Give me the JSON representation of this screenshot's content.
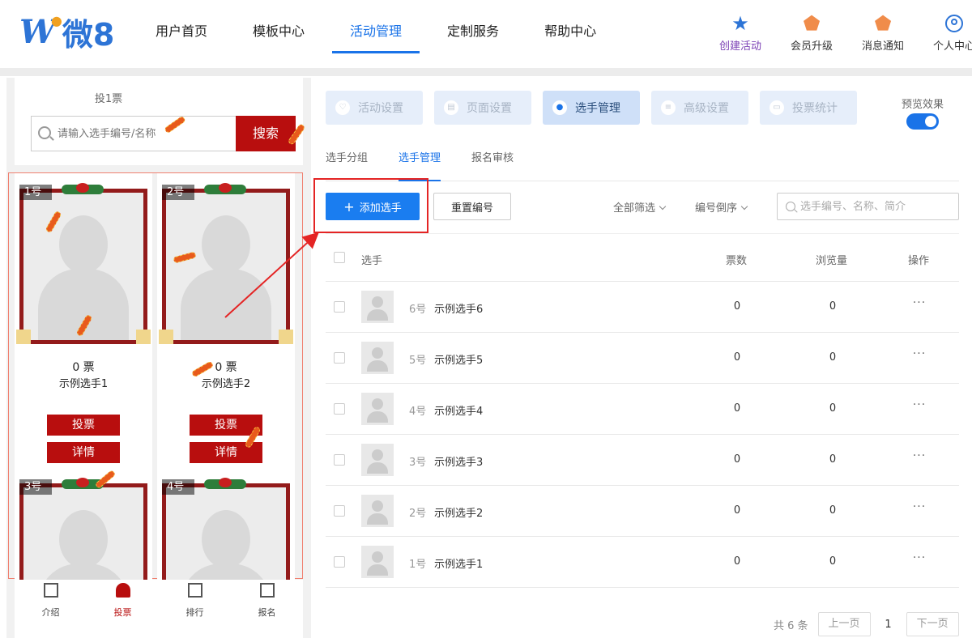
{
  "header": {
    "logo": {
      "letter": "W",
      "text": "微8"
    },
    "nav": [
      {
        "label": "用户首页",
        "active": false
      },
      {
        "label": "模板中心",
        "active": false
      },
      {
        "label": "活动管理",
        "active": true
      },
      {
        "label": "定制服务",
        "active": false
      },
      {
        "label": "帮助中心",
        "active": false
      }
    ],
    "tools": [
      {
        "label": "创建活动",
        "icon": "star-icon"
      },
      {
        "label": "会员升级",
        "icon": "shield-icon"
      },
      {
        "label": "消息通知",
        "icon": "shield-icon"
      },
      {
        "label": "个人中心",
        "icon": "user-icon"
      }
    ]
  },
  "phone": {
    "votes_label": "投1票",
    "search_placeholder": "请输入选手编号/名称",
    "search_button": "搜索",
    "cards": [
      {
        "badge": "1号",
        "votes": "0 票",
        "name": "示例选手1",
        "vote_btn": "投票",
        "detail_btn": "详情"
      },
      {
        "badge": "2号",
        "votes": "0 票",
        "name": "示例选手2",
        "vote_btn": "投票",
        "detail_btn": "详情"
      },
      {
        "badge": "3号"
      },
      {
        "badge": "4号"
      }
    ],
    "tabbar": [
      {
        "label": "介绍",
        "active": false
      },
      {
        "label": "投票",
        "active": true
      },
      {
        "label": "排行",
        "active": false
      },
      {
        "label": "报名",
        "active": false
      }
    ]
  },
  "steps": [
    {
      "label": "活动设置",
      "active": false
    },
    {
      "label": "页面设置",
      "active": false
    },
    {
      "label": "选手管理",
      "active": true
    },
    {
      "label": "高级设置",
      "active": false
    },
    {
      "label": "投票统计",
      "active": false
    }
  ],
  "preview": {
    "label": "预览效果",
    "on": true
  },
  "subtabs": [
    {
      "label": "选手分组",
      "active": false
    },
    {
      "label": "选手管理",
      "active": true
    },
    {
      "label": "报名审核",
      "active": false
    }
  ],
  "toolbar": {
    "add_label": "添加选手",
    "renumber_label": "重置编号",
    "filter_label": "全部筛选",
    "sort_label": "编号倒序",
    "search_placeholder": "选手编号、名称、简介"
  },
  "table": {
    "headers": {
      "player": "选手",
      "votes": "票数",
      "views": "浏览量",
      "ops": "操作"
    },
    "rows": [
      {
        "num": "6号",
        "name": "示例选手6",
        "votes": "0",
        "views": "0",
        "ops": "···"
      },
      {
        "num": "5号",
        "name": "示例选手5",
        "votes": "0",
        "views": "0",
        "ops": "···"
      },
      {
        "num": "4号",
        "name": "示例选手4",
        "votes": "0",
        "views": "0",
        "ops": "···"
      },
      {
        "num": "3号",
        "name": "示例选手3",
        "votes": "0",
        "views": "0",
        "ops": "···"
      },
      {
        "num": "2号",
        "name": "示例选手2",
        "votes": "0",
        "views": "0",
        "ops": "···"
      },
      {
        "num": "1号",
        "name": "示例选手1",
        "votes": "0",
        "views": "0",
        "ops": "···"
      }
    ]
  },
  "pager": {
    "total": "共 6 条",
    "prev": "上一页",
    "page": "1",
    "next": "下一页"
  },
  "colors": {
    "primary": "#1a73e8",
    "vote_red": "#b80e0e",
    "highlight": "#e42424"
  }
}
